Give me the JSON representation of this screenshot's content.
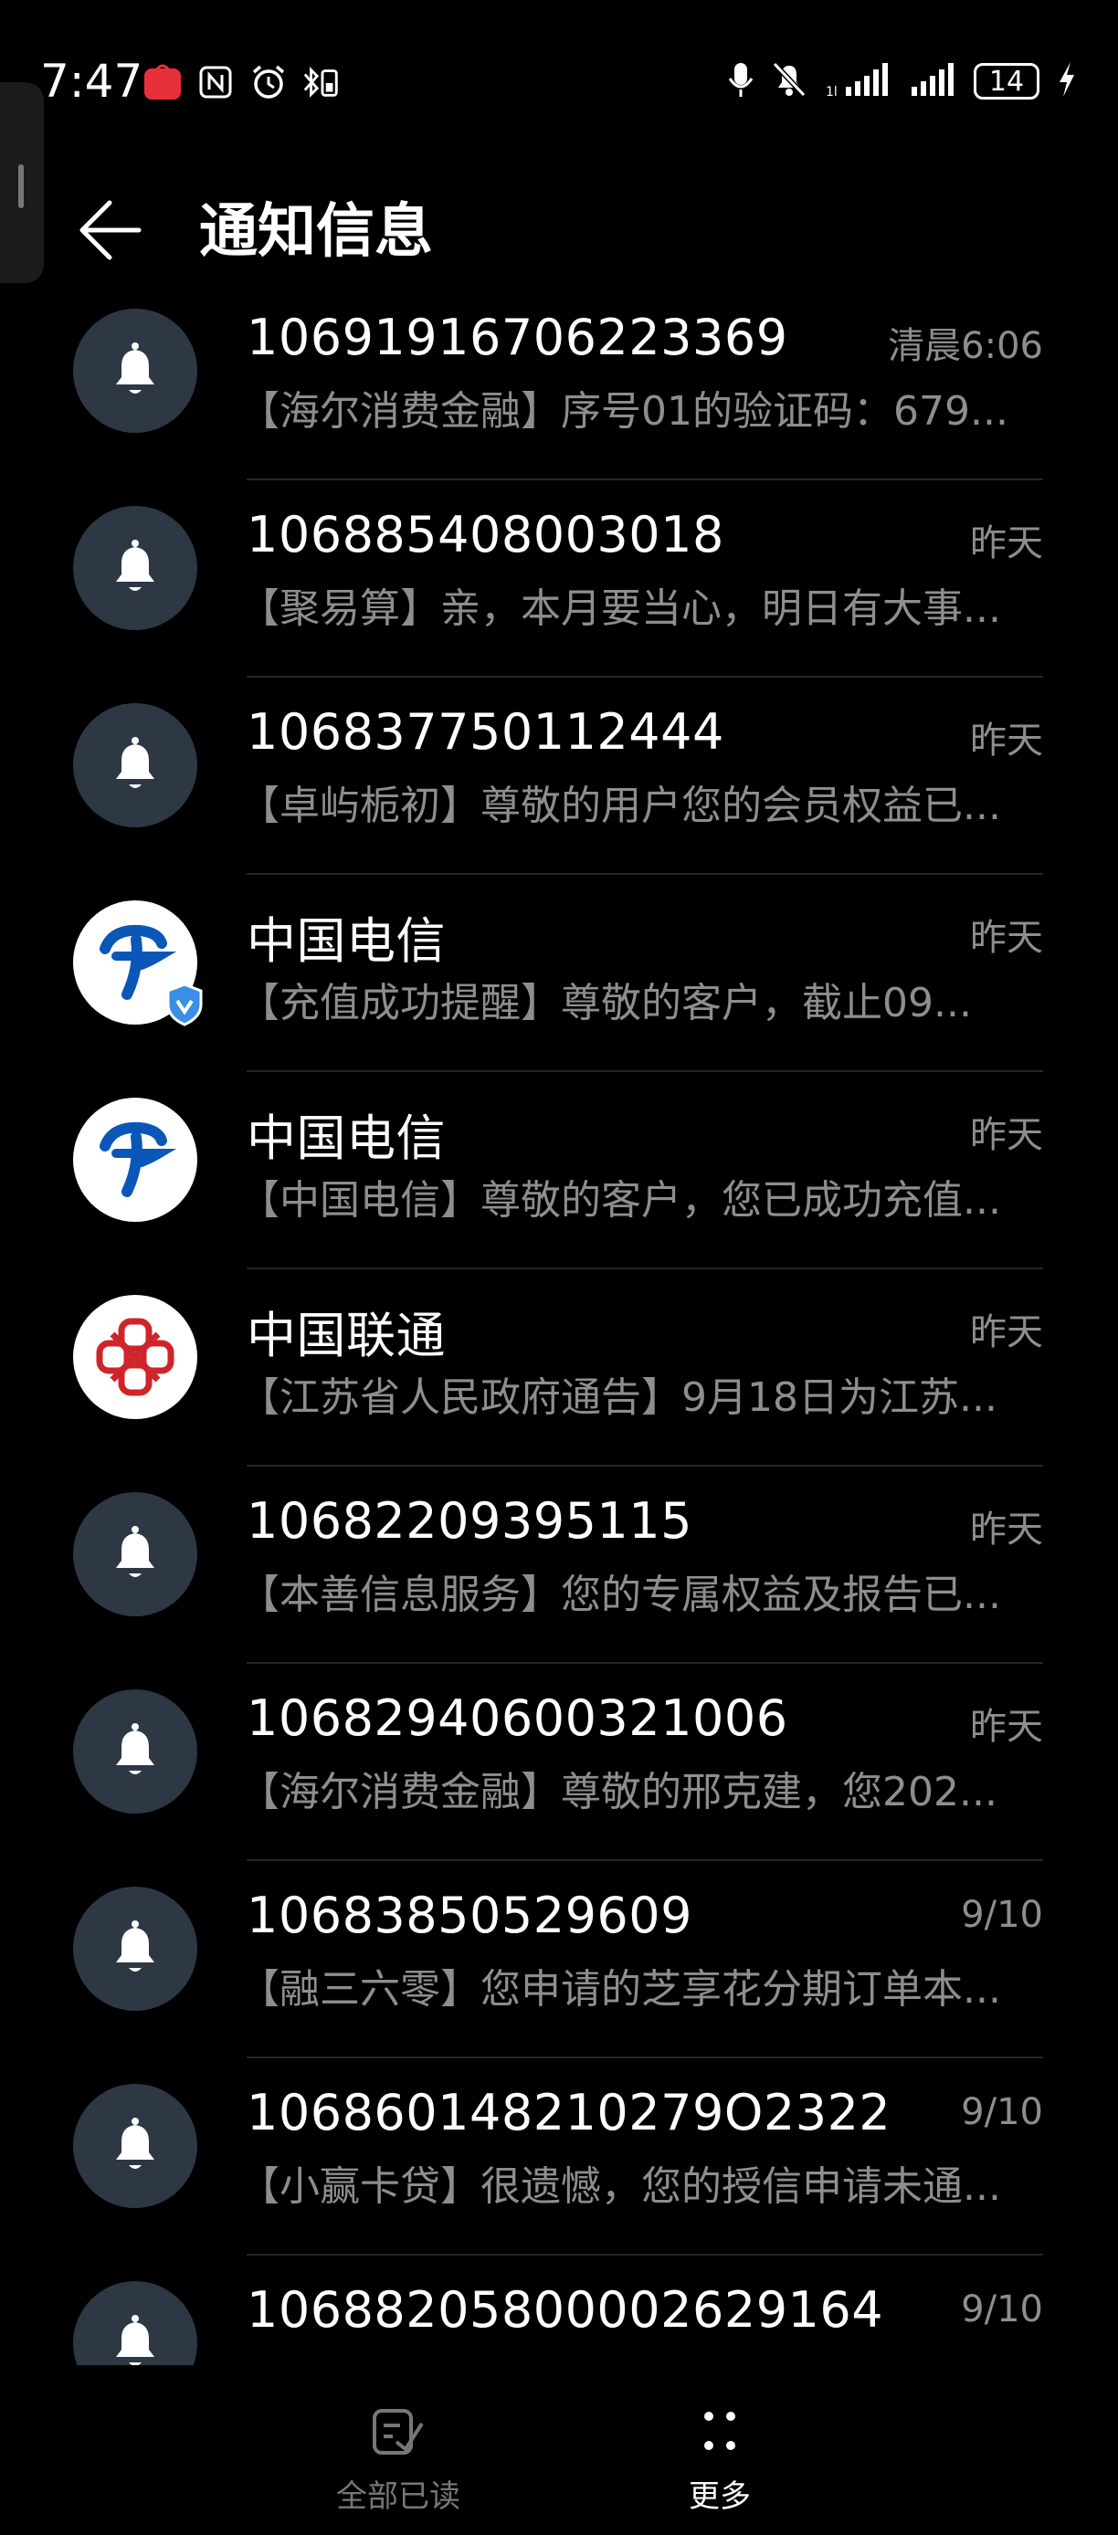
{
  "status_bar": {
    "time": "7:47",
    "battery": "14"
  },
  "header": {
    "title": "通知信息"
  },
  "messages": [
    {
      "sender": "10691916706223369",
      "time": "清晨6:06",
      "preview": "【海尔消费金融】序号01的验证码：679...",
      "avatar": "bell-icon"
    },
    {
      "sender": "106885408003018",
      "time": "昨天",
      "preview": "【聚易算】亲，本月要当心，明日有大事...",
      "avatar": "bell-icon"
    },
    {
      "sender": "106837750112444",
      "time": "昨天",
      "preview": "【卓屿栀初】尊敬的用户您的会员权益已...",
      "avatar": "bell-icon"
    },
    {
      "sender": "中国电信",
      "time": "昨天",
      "preview": "【充值成功提醒】尊敬的客户，截止09...",
      "avatar": "china-telecom-logo",
      "verified": true
    },
    {
      "sender": "中国电信",
      "time": "昨天",
      "preview": "【中国电信】尊敬的客户，您已成功充值...",
      "avatar": "china-telecom-logo"
    },
    {
      "sender": "中国联通",
      "time": "昨天",
      "preview": "【江苏省人民政府通告】9月18日为江苏...",
      "avatar": "china-unicom-logo"
    },
    {
      "sender": "10682209395115",
      "time": "昨天",
      "preview": "【本善信息服务】您的专属权益及报告已...",
      "avatar": "bell-icon"
    },
    {
      "sender": "10682940600321006",
      "time": "昨天",
      "preview": "【海尔消费金融】尊敬的邢克建，您202...",
      "avatar": "bell-icon"
    },
    {
      "sender": "10683850529609",
      "time": "9/10",
      "preview": "【融三六零】您申请的芝享花分期订单本...",
      "avatar": "bell-icon"
    },
    {
      "sender": "106860148210279O2322",
      "time": "9/10",
      "preview": "【小赢卡贷】很遗憾，您的授信申请未通...",
      "avatar": "bell-icon"
    },
    {
      "sender": "1068820580000262916​4",
      "time": "9/10",
      "preview": "",
      "avatar": "bell-icon"
    }
  ],
  "bottom_bar": {
    "mark_all_read": "全部已读",
    "more": "更多"
  },
  "colors": {
    "background": "#000000",
    "avatar_bg": "#2e3744",
    "secondary_text": "#8e8e8e",
    "telecom_blue": "#0a57b8",
    "unicom_red": "#d0242b"
  }
}
